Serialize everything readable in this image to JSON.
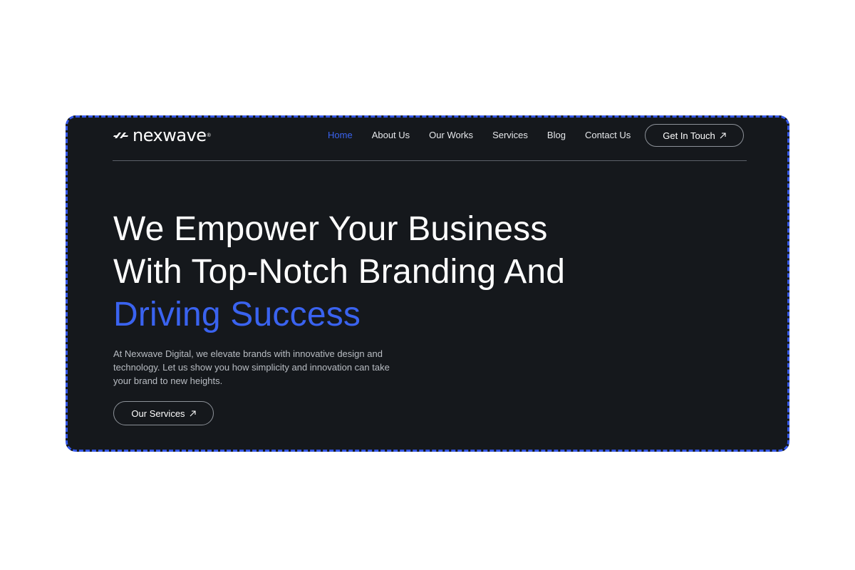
{
  "brand": {
    "name": "nexwave",
    "registered_mark": "®"
  },
  "nav": {
    "items": [
      {
        "label": "Home",
        "active": true
      },
      {
        "label": "About Us",
        "active": false
      },
      {
        "label": "Our Works",
        "active": false
      },
      {
        "label": "Services",
        "active": false
      },
      {
        "label": "Blog",
        "active": false
      },
      {
        "label": "Contact Us",
        "active": false
      }
    ],
    "cta_label": "Get In Touch",
    "cta_icon": "arrow-up-right-icon"
  },
  "hero": {
    "title_line1": "We Empower Your Business",
    "title_line2": "With Top-Notch Branding And",
    "title_accent": "Driving Success",
    "description": "At Nexwave Digital, we elevate brands with innovative design and technology. Let us show you how simplicity and innovation can take your brand to new heights.",
    "button_label": "Our Services",
    "button_icon": "arrow-up-right-icon"
  },
  "colors": {
    "background": "#15181c",
    "accent": "#3a63f0",
    "selection_border": "#3558e8",
    "text": "#ffffff",
    "muted_text": "#b9bdc3"
  }
}
